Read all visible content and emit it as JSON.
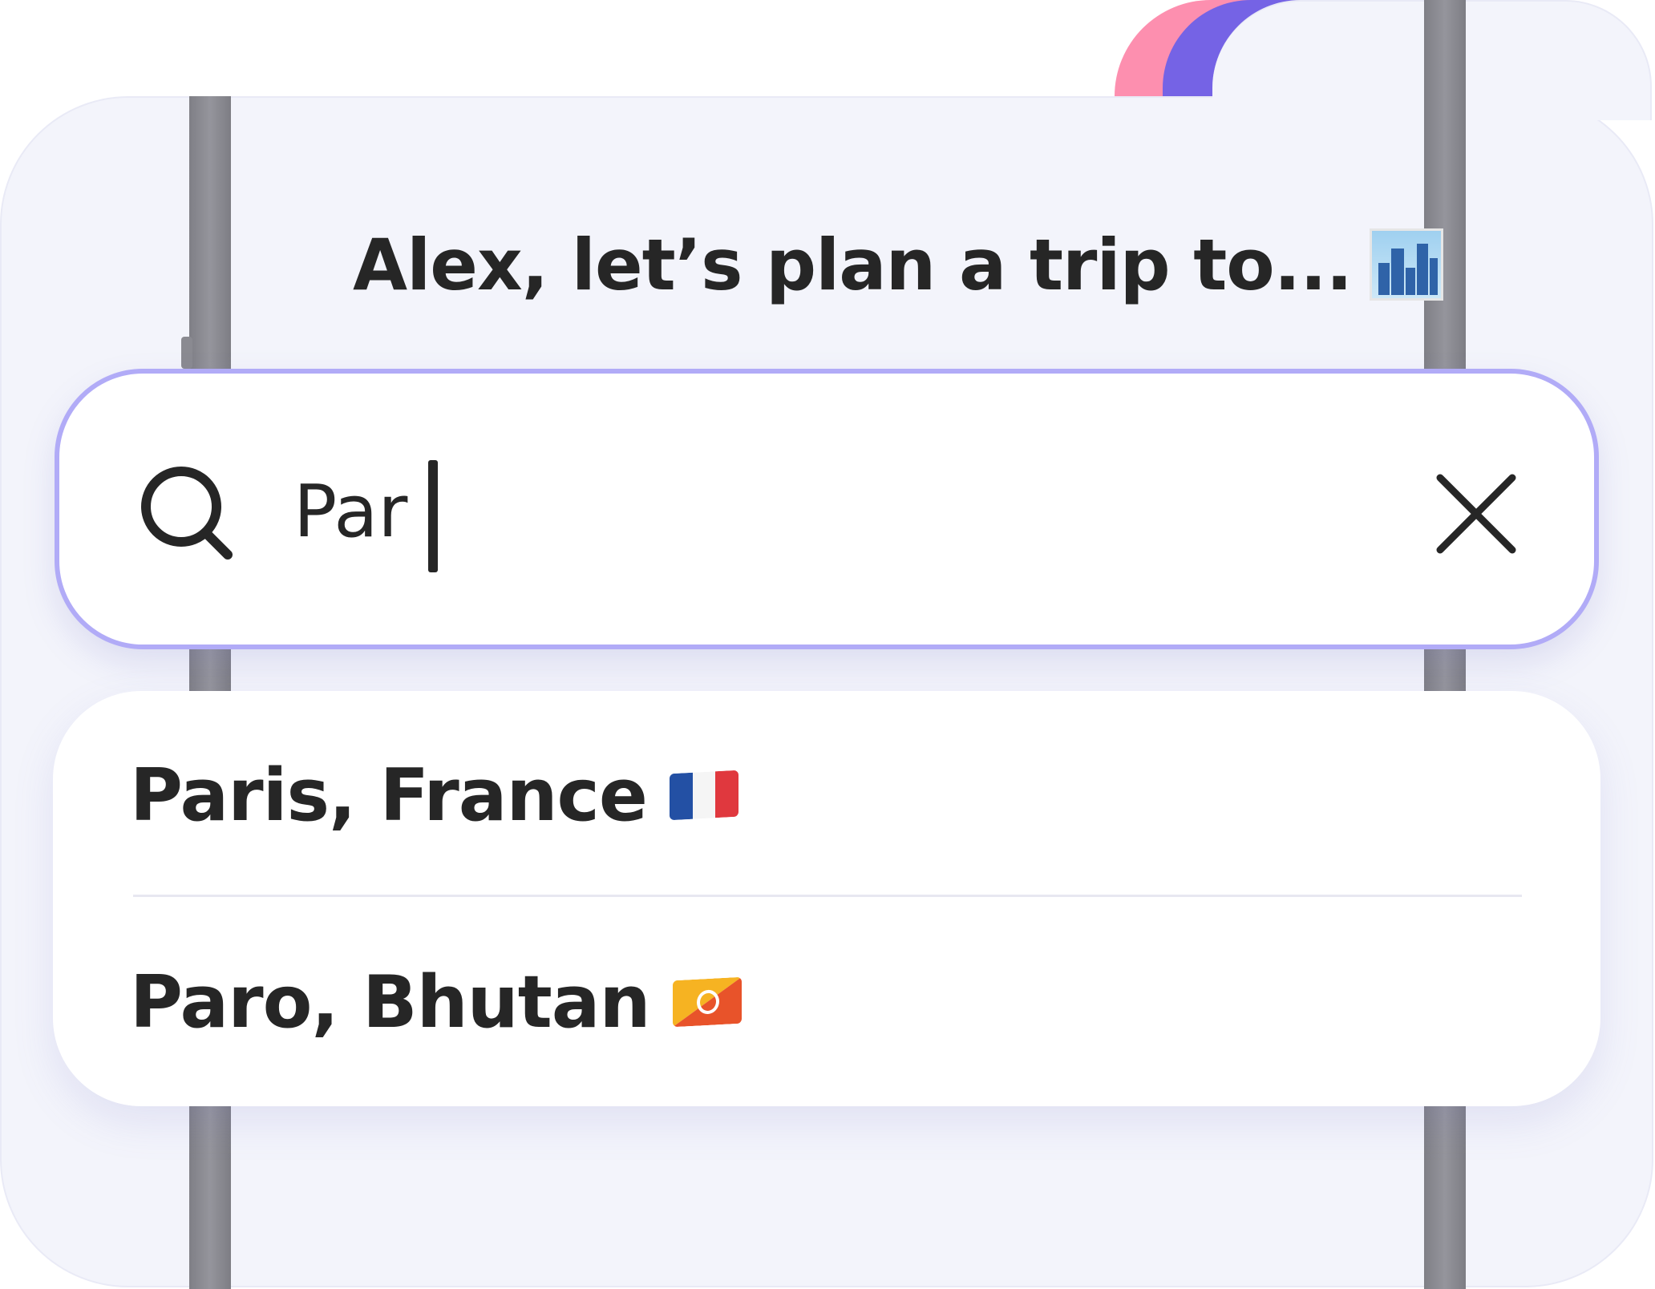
{
  "header": {
    "title": "Alex, let’s plan a trip to...",
    "title_emoji": "cityscape-icon"
  },
  "search": {
    "value": "Par",
    "icon": "search-icon",
    "clear_icon": "close-icon"
  },
  "results": [
    {
      "label": "Paris, France",
      "flag": "france-flag-icon"
    },
    {
      "label": "Paro, Bhutan",
      "flag": "bhutan-flag-icon"
    }
  ],
  "colors": {
    "accent_border": "#b1abf7",
    "ribbon_pink": "#fd8faf",
    "ribbon_purple": "#7563e5",
    "background": "#f3f4fb",
    "text": "#262626"
  }
}
